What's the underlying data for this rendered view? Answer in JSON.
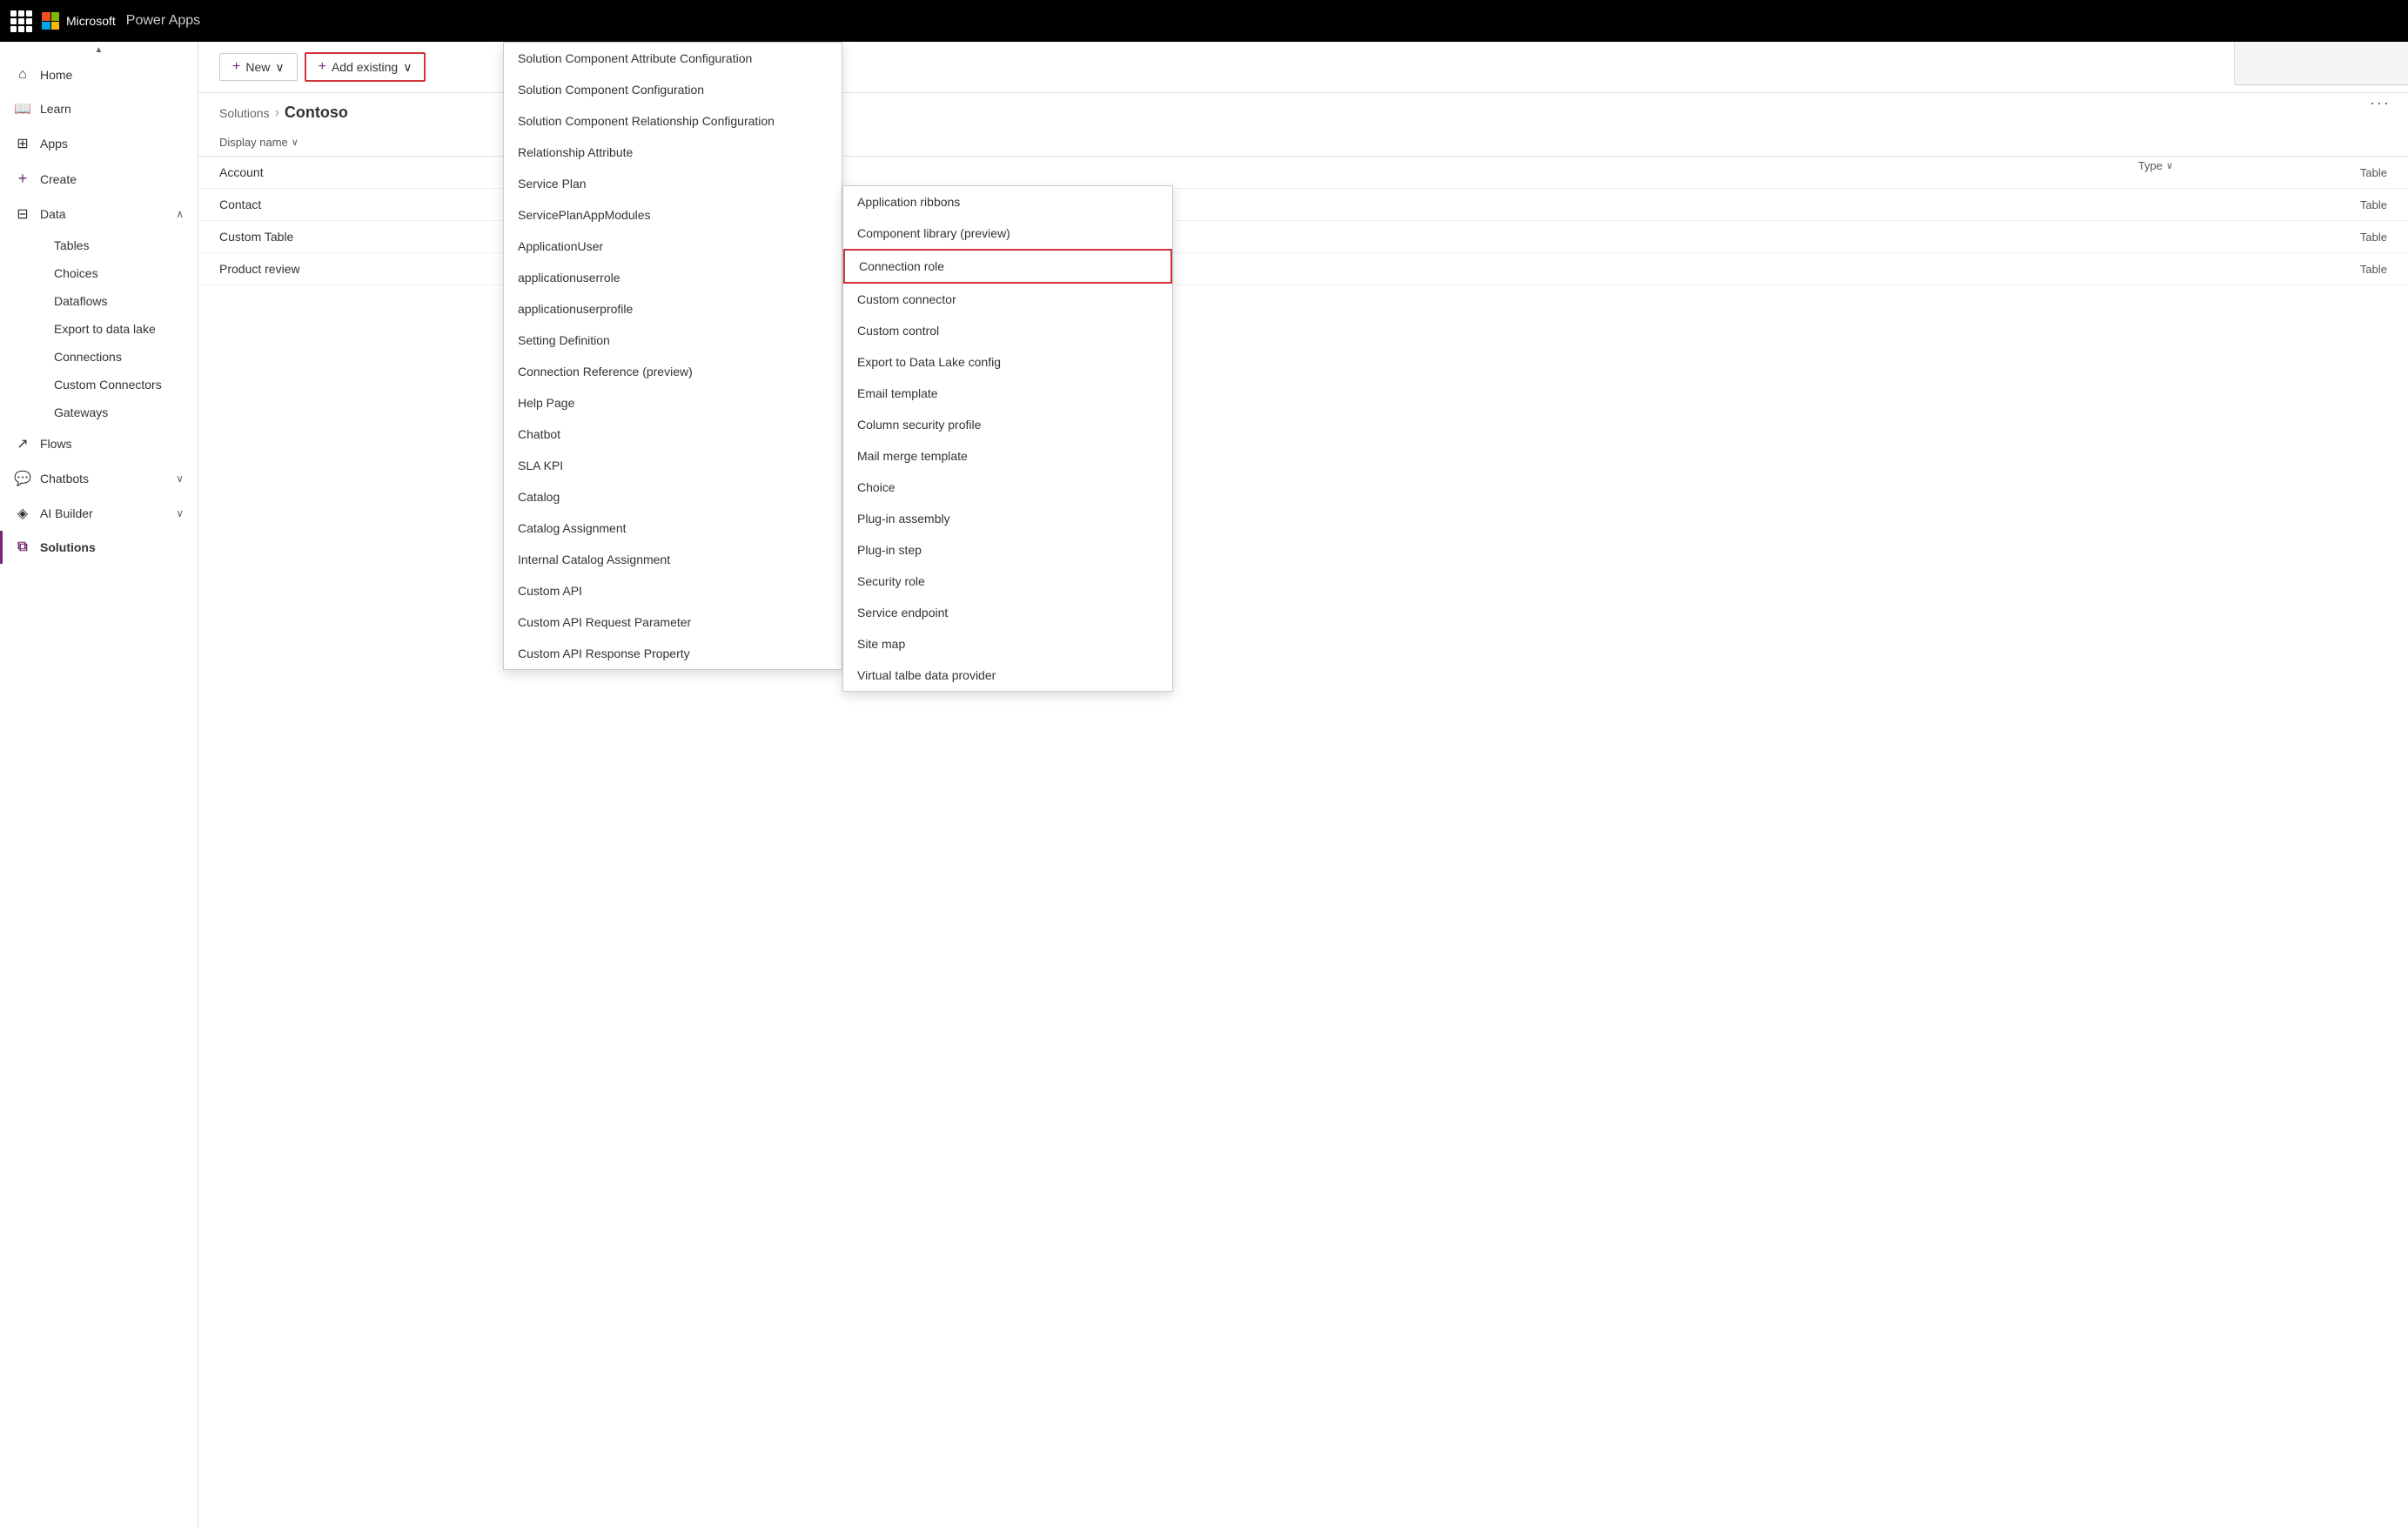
{
  "topbar": {
    "brand": "Power Apps",
    "microsoft_label": "Microsoft"
  },
  "sidebar": {
    "scroll_up_label": "▲",
    "items": [
      {
        "id": "home",
        "label": "Home",
        "icon": "⌂",
        "has_chevron": false
      },
      {
        "id": "learn",
        "label": "Learn",
        "icon": "📖",
        "has_chevron": false
      },
      {
        "id": "apps",
        "label": "Apps",
        "icon": "⊞",
        "has_chevron": false
      },
      {
        "id": "create",
        "label": "Create",
        "icon": "+",
        "has_chevron": false
      },
      {
        "id": "data",
        "label": "Data",
        "icon": "⊟",
        "has_chevron": true,
        "expanded": true
      },
      {
        "id": "flows",
        "label": "Flows",
        "icon": "↗",
        "has_chevron": false
      },
      {
        "id": "chatbots",
        "label": "Chatbots",
        "icon": "💬",
        "has_chevron": true
      },
      {
        "id": "ai-builder",
        "label": "AI Builder",
        "icon": "◈",
        "has_chevron": true
      },
      {
        "id": "solutions",
        "label": "Solutions",
        "icon": "⧉",
        "has_chevron": false,
        "active": true
      }
    ],
    "data_sub_items": [
      {
        "id": "tables",
        "label": "Tables"
      },
      {
        "id": "choices",
        "label": "Choices"
      },
      {
        "id": "dataflows",
        "label": "Dataflows"
      },
      {
        "id": "export-data-lake",
        "label": "Export to data lake"
      },
      {
        "id": "connections",
        "label": "Connections"
      },
      {
        "id": "custom-connectors",
        "label": "Custom Connectors"
      },
      {
        "id": "gateways",
        "label": "Gateways"
      }
    ]
  },
  "toolbar": {
    "new_label": "New",
    "add_existing_label": "Add existing"
  },
  "breadcrumb": {
    "parent": "Solutions",
    "separator": "›",
    "current": "Contoso"
  },
  "table": {
    "col_display_name": "Display name",
    "col_type": "Type",
    "rows": [
      {
        "name": "Account",
        "type": "Table"
      },
      {
        "name": "Contact",
        "type": "Table"
      },
      {
        "name": "Custom Table",
        "type": "Table"
      },
      {
        "name": "Product review",
        "type": "Table"
      }
    ]
  },
  "right_panel": {
    "more_icon": "···"
  },
  "dropdown1": {
    "items": [
      {
        "label": "Solution Component Attribute Configuration"
      },
      {
        "label": "Solution Component Configuration"
      },
      {
        "label": "Solution Component Relationship Configuration"
      },
      {
        "label": "Relationship Attribute"
      },
      {
        "label": "Service Plan"
      },
      {
        "label": "ServicePlanAppModules"
      },
      {
        "label": "ApplicationUser"
      },
      {
        "label": "applicationuserrole"
      },
      {
        "label": "applicationuserprofile"
      },
      {
        "label": "Setting Definition"
      },
      {
        "label": "Connection Reference (preview)"
      },
      {
        "label": "Help Page"
      },
      {
        "label": "Chatbot"
      },
      {
        "label": "SLA KPI"
      },
      {
        "label": "Catalog"
      },
      {
        "label": "Catalog Assignment"
      },
      {
        "label": "Internal Catalog Assignment"
      },
      {
        "label": "Custom API"
      },
      {
        "label": "Custom API Request Parameter"
      },
      {
        "label": "Custom API Response Property"
      }
    ]
  },
  "dropdown2": {
    "items": [
      {
        "label": "Application ribbons",
        "highlighted": false
      },
      {
        "label": "Component library (preview)",
        "highlighted": false
      },
      {
        "label": "Connection role",
        "highlighted": true
      },
      {
        "label": "Custom connector",
        "highlighted": false
      },
      {
        "label": "Custom control",
        "highlighted": false
      },
      {
        "label": "Export to Data Lake config",
        "highlighted": false
      },
      {
        "label": "Email template",
        "highlighted": false
      },
      {
        "label": "Column security profile",
        "highlighted": false
      },
      {
        "label": "Mail merge template",
        "highlighted": false
      },
      {
        "label": "Choice",
        "highlighted": false
      },
      {
        "label": "Plug-in assembly",
        "highlighted": false
      },
      {
        "label": "Plug-in step",
        "highlighted": false
      },
      {
        "label": "Security role",
        "highlighted": false
      },
      {
        "label": "Service endpoint",
        "highlighted": false
      },
      {
        "label": "Site map",
        "highlighted": false
      },
      {
        "label": "Virtual talbe data provider",
        "highlighted": false
      }
    ]
  },
  "icons": {
    "chevron_down": "∨",
    "chevron_up": "∧",
    "plus": "+",
    "waffle": "⊞",
    "sort": "∨"
  }
}
